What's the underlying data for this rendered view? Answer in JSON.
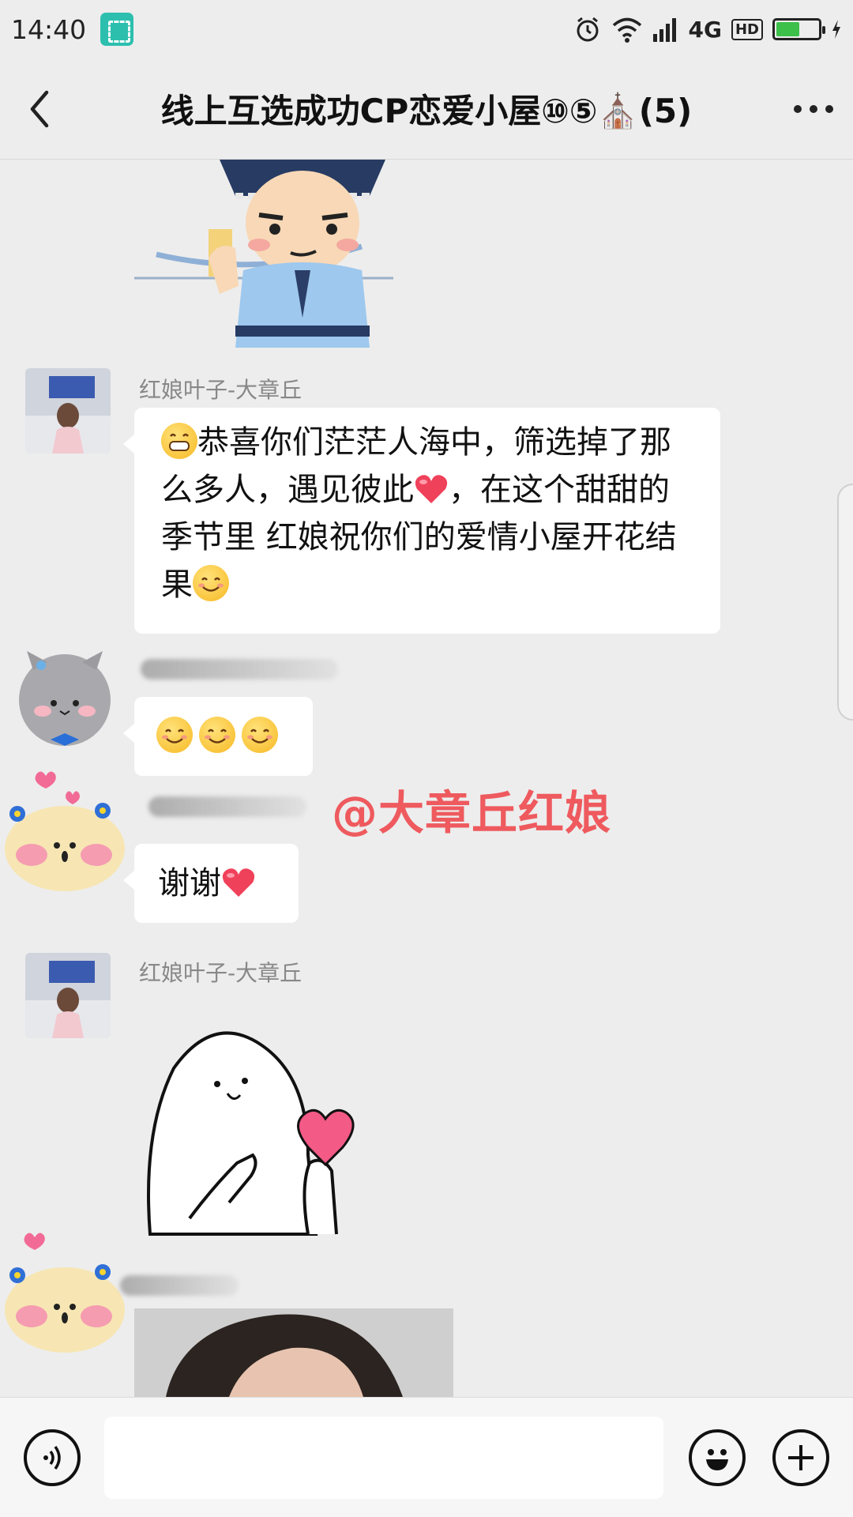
{
  "status": {
    "time": "14:40",
    "network": "4G",
    "hd": "HD"
  },
  "header": {
    "title": "线上互选成功CP恋爱小屋⑩⑤⛪(5)"
  },
  "messages": {
    "m1": {
      "sender": "红娘叶子-大章丘",
      "text_a": "恭喜你们茫茫人海中，筛选掉了那么多人，遇见彼此",
      "text_b": "，在这个甜甜的季节里 红娘祝你们的爱情小屋开花结果"
    },
    "m3": {
      "text": "谢谢"
    },
    "m4": {
      "sender": "红娘叶子-大章丘"
    }
  },
  "watermark": "@大章丘红娘",
  "input": {
    "placeholder": ""
  },
  "colors": {
    "background": "#ededed",
    "bubble": "#ffffff",
    "watermark": "#ef4b4f",
    "battery": "#3cc04a"
  }
}
